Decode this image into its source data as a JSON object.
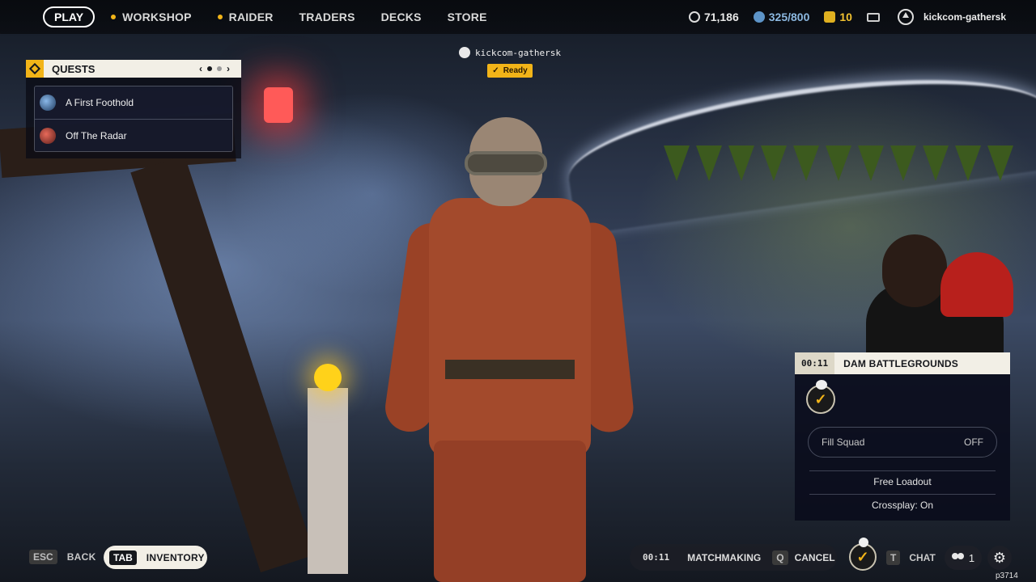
{
  "nav": {
    "play": "PLAY",
    "workshop": "WORKSHOP",
    "raider": "RAIDER",
    "traders": "TRADERS",
    "decks": "DECKS",
    "store": "STORE"
  },
  "currencies": {
    "coins": "71,186",
    "credits": "325/800",
    "tokens": "10"
  },
  "user": {
    "name": "kickcom-gathersk"
  },
  "quests": {
    "title": "QUESTS",
    "prev": "‹",
    "next": "›",
    "items": [
      {
        "label": "A First Foothold",
        "icon": "quest-globe-icon"
      },
      {
        "label": "Off The Radar",
        "icon": "quest-radar-icon"
      }
    ]
  },
  "player_tag": {
    "name": "kickcom-gathersk",
    "status": "Ready"
  },
  "matchmaking_panel": {
    "timer": "00:11",
    "map": "DAM BATTLEGROUNDS",
    "fill_squad_label": "Fill Squad",
    "fill_squad_value": "OFF",
    "loadout": "Free Loadout",
    "crossplay": "Crossplay: On"
  },
  "bottom": {
    "back_key": "ESC",
    "back_label": "BACK",
    "inventory_key": "TAB",
    "inventory_label": "INVENTORY",
    "mm_timer": "00:11",
    "mm_label": "MATCHMAKING",
    "cancel_key": "Q",
    "cancel_label": "CANCEL",
    "chat_key": "T",
    "chat_label": "CHAT",
    "friends_count": "1",
    "build": "p3714"
  },
  "colors": {
    "accent": "#f2b418",
    "panel_header": "#f2efe6",
    "panel_bg": "#0a0c1c"
  }
}
